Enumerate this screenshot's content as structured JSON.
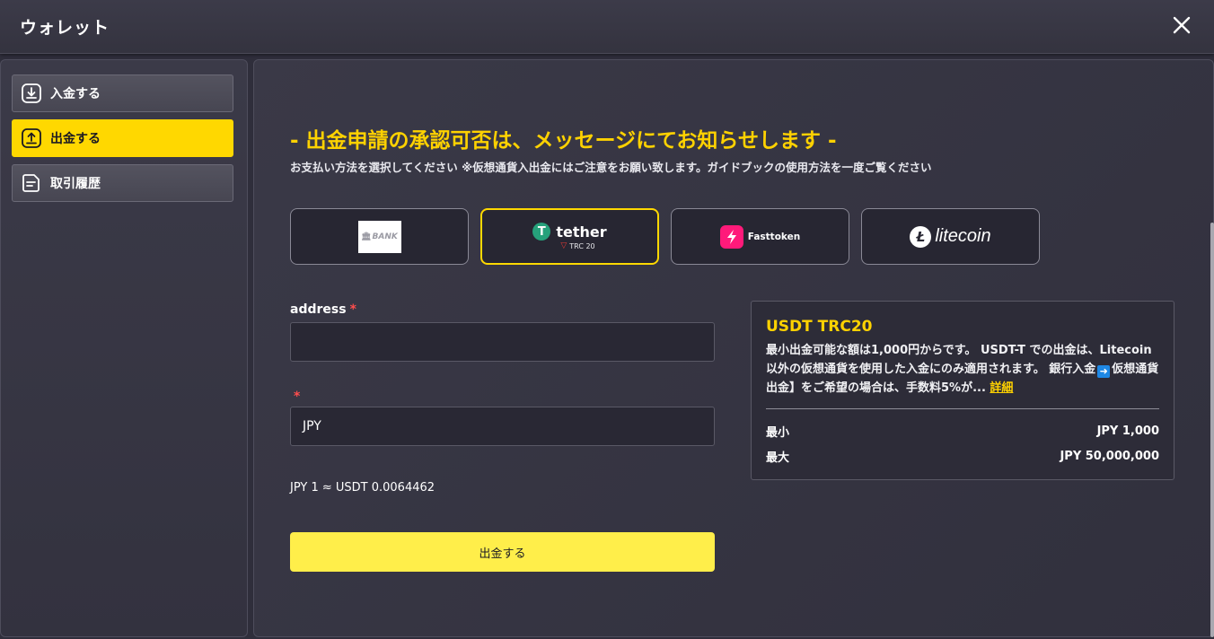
{
  "header": {
    "title": "ウォレット"
  },
  "sidebar": {
    "items": [
      {
        "label": "入金する",
        "icon": "download-icon",
        "active": false
      },
      {
        "label": "出金する",
        "icon": "upload-icon",
        "active": true
      },
      {
        "label": "取引履歴",
        "icon": "document-icon",
        "active": false
      }
    ]
  },
  "main": {
    "headline": "- 出金申請の承認可否は、メッセージにてお知らせします -",
    "subtitle": "お支払い方法を選択してください ※仮想通貨入出金にはご注意をお願い致します。ガイドブックの使用方法を一度ご覧ください",
    "payment_methods": [
      {
        "name": "BANK",
        "logo_text": "BANK"
      },
      {
        "name": "tether",
        "sub": "TRC 20",
        "selected": true
      },
      {
        "name": "Fasttoken"
      },
      {
        "name": "litecoin"
      }
    ],
    "form": {
      "address_label": "address",
      "address_value": "",
      "required_mark": "*",
      "currency_value": "JPY",
      "rate": "JPY 1 ≈ USDT 0.0064462",
      "submit_label": "出金する"
    },
    "info": {
      "title": "USDT TRC20",
      "desc_1": "最小出金可能な額は1,000円からです。 USDT-T での出金は、Litecoin 以外の仮想通貨を使用した入金にのみ適用されます。 銀行入金",
      "desc_2": "仮想通貨出金】をご希望の場合は、手数料5%が...",
      "detail_link": "詳細",
      "min_label": "最小",
      "min_value": "JPY 1,000",
      "max_label": "最大",
      "max_value": "JPY 50,000,000"
    }
  },
  "colors": {
    "accent": "#ffd800",
    "button": "#ffee4a",
    "background": "#2f2e3b"
  }
}
